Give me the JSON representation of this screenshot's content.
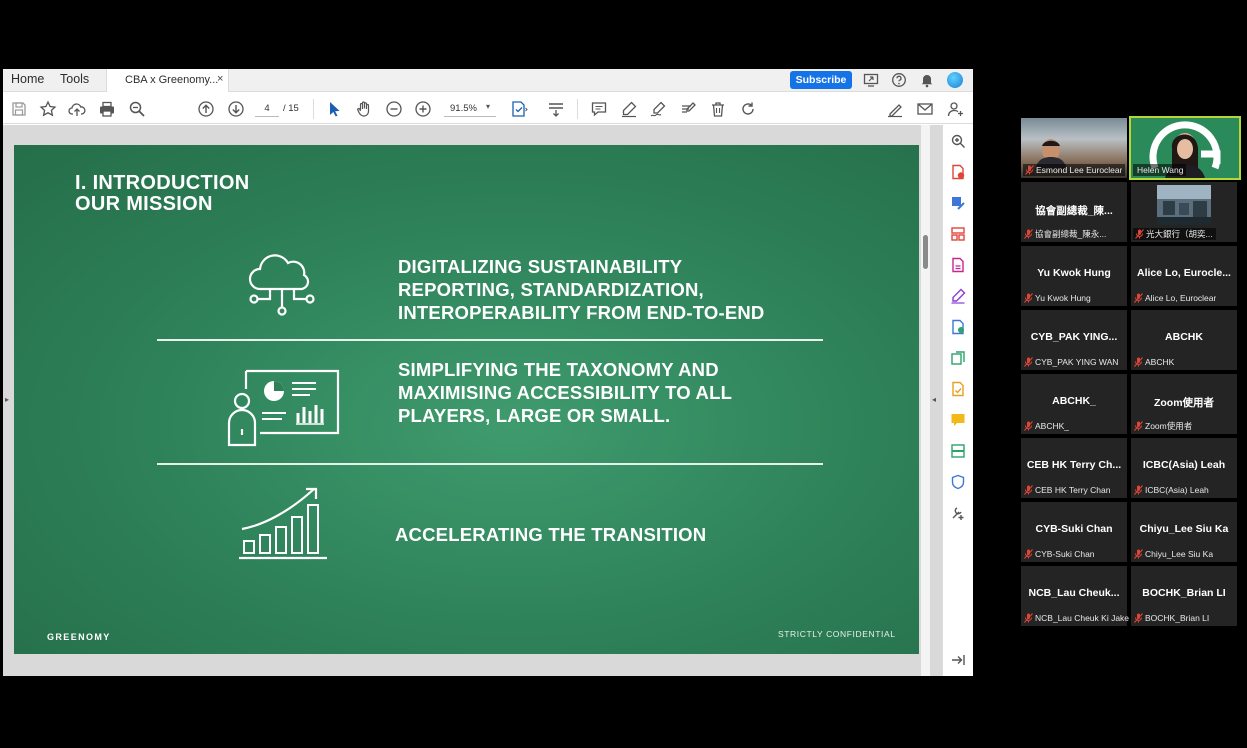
{
  "acrobat": {
    "nav_home": "Home",
    "nav_tools": "Tools",
    "doc_tab": "CBA x Greenomy...",
    "tab_close": "×",
    "subscribe": "Subscribe",
    "page_current": "4",
    "page_total": "/ 15",
    "zoom": "91.5%",
    "zoom_caret": "▾",
    "accent_color": "#1473e6"
  },
  "slide": {
    "title_line1": "I. INTRODUCTION",
    "title_line2": "OUR MISSION",
    "point1": [
      "DIGITALIZING SUSTAINABILITY",
      "REPORTING, STANDARDIZATION,",
      "INTEROPERABILITY FROM END-TO-END"
    ],
    "point2": [
      "SIMPLIFYING THE TAXONOMY AND",
      "MAXIMISING ACCESSIBILITY TO ALL",
      "PLAYERS, LARGE OR SMALL."
    ],
    "point3": "ACCELERATING THE TRANSITION",
    "brand": "GREENOMY",
    "confidential": "STRICTLY CONFIDENTIAL",
    "background_color": "#2d8058"
  },
  "zoom": {
    "participants": [
      {
        "name": "",
        "label": "Esmond Lee  Euroclear",
        "video": true
      },
      {
        "name": "",
        "label": "Helen Wang",
        "video": true,
        "active_speaker": true
      },
      {
        "name": "協會副總裁_陳...",
        "label": "協會副總裁_陳永..."
      },
      {
        "name": "",
        "label": "光大銀行（胡奕...",
        "video": true
      },
      {
        "name": "Yu Kwok Hung",
        "label": "Yu Kwok Hung"
      },
      {
        "name": "Alice  Lo,  Euroclе...",
        "label": "Alice Lo, Euroclear"
      },
      {
        "name": "CYB_PAK  YING...",
        "label": "CYB_PAK YING WAN"
      },
      {
        "name": "ABCHK",
        "label": "ABCHK"
      },
      {
        "name": "ABCHK_",
        "label": "ABCHK_"
      },
      {
        "name": "Zoom使用者",
        "label": "Zoom使用者"
      },
      {
        "name": "CEB  HK  Terry  Ch...",
        "label": "CEB HK Terry Chan"
      },
      {
        "name": "ICBC(Asia)  Leah",
        "label": "ICBC(Asia) Leah"
      },
      {
        "name": "CYB-Suki  Chan",
        "label": "CYB-Suki Chan"
      },
      {
        "name": "Chiyu_Lee  Siu  Ka",
        "label": "Chiyu_Lee Siu Ka"
      },
      {
        "name": "NCB_Lau  Cheuk...",
        "label": "NCB_Lau Cheuk Ki Jake"
      },
      {
        "name": "BOCHK_Brian  LI",
        "label": "BOCHK_Brian LI"
      }
    ],
    "active_speaker_color": "#b5d634",
    "muted_color": "#e0453a"
  }
}
